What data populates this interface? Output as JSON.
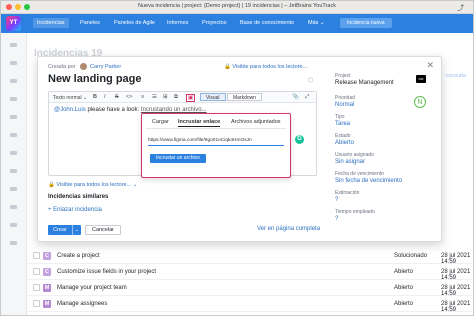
{
  "window": {
    "title": "Nueva incidencia | project: {Demo project} | 19 incidencias | – JetBrains YouTrack"
  },
  "nav": {
    "logo_text": "YT",
    "items": [
      "Incidencias",
      "Paneles",
      "Paneles de Agile",
      "Informes",
      "Proyectos",
      "Base de conocimiento",
      "Más ⌄"
    ],
    "new_issue_label": "Incidencia nueva"
  },
  "background": {
    "page_title": "Incidencias 19",
    "right_link": "consulta",
    "rows": [
      {
        "priority": "C",
        "priority_color": "#c5a1e0",
        "summary": "Create a project",
        "state": "Solucionado",
        "date": "28 jul 2021 14:59"
      },
      {
        "priority": "C",
        "priority_color": "#c5a1e0",
        "summary": "Customize issue fields in your project",
        "state": "Abierto",
        "date": "28 jul 2021 14:59"
      },
      {
        "priority": "M",
        "priority_color": "#b58ad6",
        "summary": "Manage your project team",
        "state": "Abierto",
        "date": "28 jul 2021 14:59"
      },
      {
        "priority": "M",
        "priority_color": "#b58ad6",
        "summary": "Manage assignees",
        "state": "Abierto",
        "date": "28 jul 2021 14:59"
      }
    ]
  },
  "dialog": {
    "created_by_label": "Creada por",
    "author": "Carry Parker",
    "visibility_top": "Visible para todos los lectore...",
    "summary": "New landing page",
    "toolbar": {
      "format": "Texto normal ⌄",
      "buttons": [
        "B",
        "I",
        "S",
        "<>",
        "≡",
        "☰",
        "⊞",
        "⧉",
        "▣"
      ],
      "visual_label": "Visual",
      "markdown_label": "Markdown",
      "attach_icon": "paperclip-icon",
      "expand_icon": "expand-icon"
    },
    "body": {
      "mention": "@John.Luis",
      "text": " please have a look:",
      "embedding": "Incrustando un archivo..."
    },
    "embed_popup": {
      "tabs": [
        "Cargar",
        "Incrustar enlace",
        "Archivos adjuntados"
      ],
      "active_tab": 1,
      "url": "https://www.figma.com/file/9go01oCiqk4HmOsJn",
      "button_label": "Incrustar un archivo"
    },
    "grammarly_label": "G",
    "visibility_bottom": "Visible para todos los lectore...",
    "similar_label": "Incidencias similares",
    "link_issue_label": "+ Enlazar incidencia",
    "create_label": "Crear",
    "cancel_label": "Cancelar",
    "full_page_label": "Ver en página completa",
    "fields": [
      {
        "label": "Project",
        "value": "Release Management"
      },
      {
        "label": "Prioridad",
        "value": "Normal"
      },
      {
        "label": "Tipo",
        "value": "Tarea"
      },
      {
        "label": "Estado",
        "value": "Abierto"
      },
      {
        "label": "Usuario asignado",
        "value": "Sin asignar"
      },
      {
        "label": "Fecha de vencimiento",
        "value": "Sin fecha de vencimiento"
      },
      {
        "label": "Estimación",
        "value": "?"
      },
      {
        "label": "Tiempo empleado",
        "value": "?"
      }
    ],
    "project_logo_text": "RM",
    "priority_badge": "N"
  }
}
